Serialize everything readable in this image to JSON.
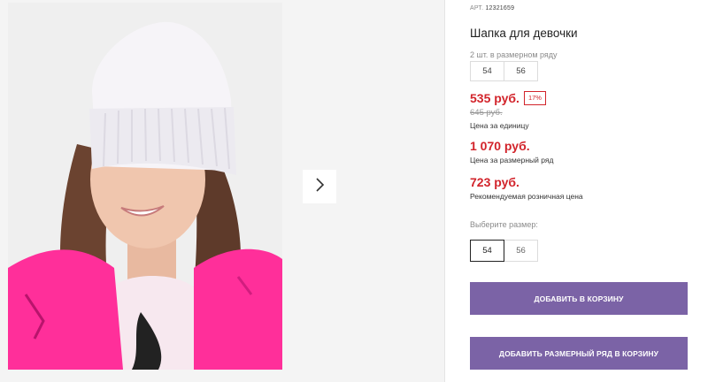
{
  "product": {
    "sku_label": "АРТ.",
    "sku": "12321659",
    "title": "Шапка для девочки",
    "series_label": "2 шт. в размерном ряду",
    "series_sizes": [
      "54",
      "56"
    ]
  },
  "pricing": {
    "unit_price": "535 руб.",
    "discount": "17%",
    "old_price": "645 руб.",
    "unit_caption": "Цена за единицу",
    "series_price": "1 070 руб.",
    "series_caption": "Цена за размерный ряд",
    "rrp_price": "723 руб.",
    "rrp_caption": "Рекомендуемая розничная цена"
  },
  "size_picker": {
    "label": "Выберите размер:",
    "options": [
      "54",
      "56"
    ],
    "selected": "54"
  },
  "actions": {
    "add_to_cart": "ДОБАВИТЬ В КОРЗИНУ",
    "add_series_to_cart": "ДОБАВИТЬ РАЗМЕРНЫЙ РЯД В КОРЗИНУ"
  },
  "gallery": {
    "next_icon": "chevron-right-icon"
  },
  "colors": {
    "accent": "#7b63a6",
    "price": "#d2242b"
  }
}
